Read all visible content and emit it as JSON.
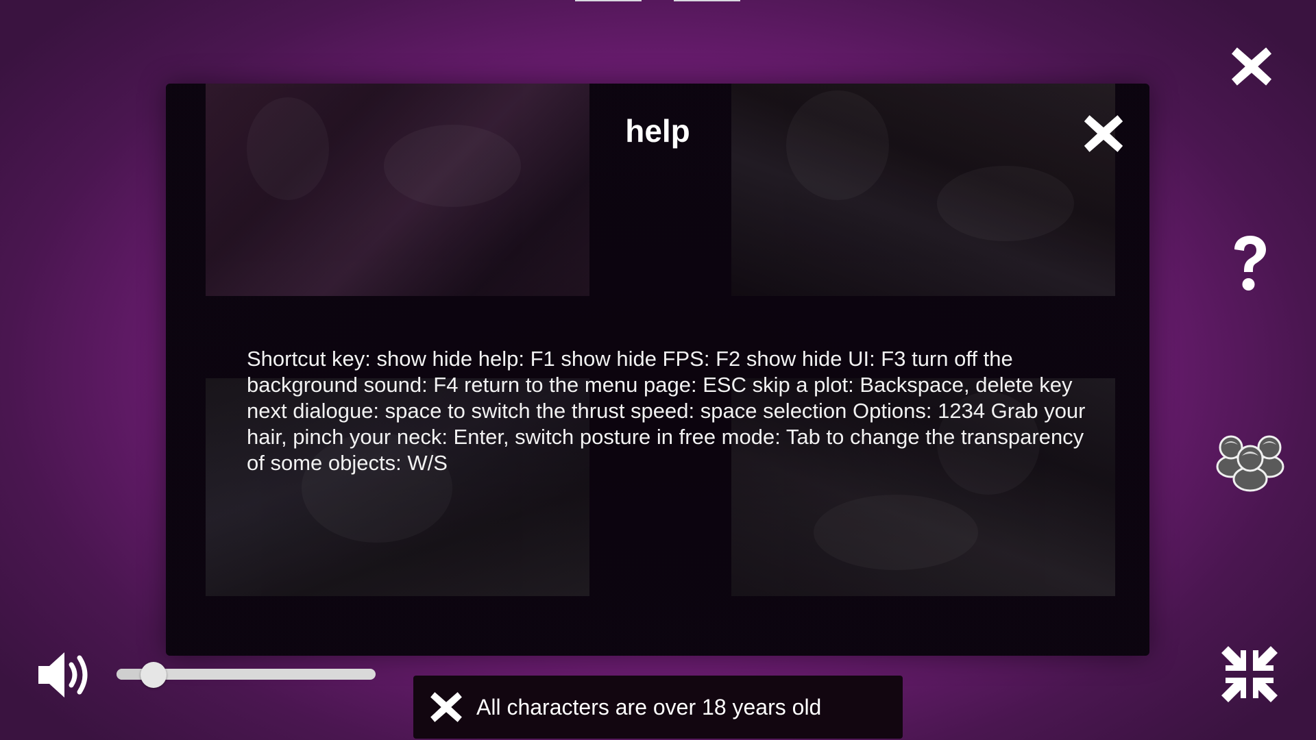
{
  "top_tabs": [
    "",
    ""
  ],
  "side_buttons": {
    "close_icon": "close-icon",
    "help_icon": "question-mark-icon",
    "characters_icon": "characters-group-icon",
    "fullscreen_icon": "exit-fullscreen-icon"
  },
  "help_panel": {
    "title": "help",
    "close_icon": "close-icon",
    "text": "Shortcut key: show hide help: F1 show hide FPS: F2 show hide UI: F3 turn off the background sound: F4 return to the menu page: ESC skip a plot: Backspace, delete key next dialogue: space to switch the thrust speed: space selection Options: 1234 Grab your hair, pinch your neck: Enter, switch posture in free mode: Tab to change the transparency of some objects: W/S"
  },
  "volume": {
    "icon": "speaker-volume-icon",
    "level": 0.11
  },
  "age_notice": {
    "close_icon": "close-icon",
    "text": "All characters are over 18 years old"
  },
  "colors": {
    "background": "#8a2490",
    "panel": "#0d0510",
    "accent": "#ffffff"
  }
}
